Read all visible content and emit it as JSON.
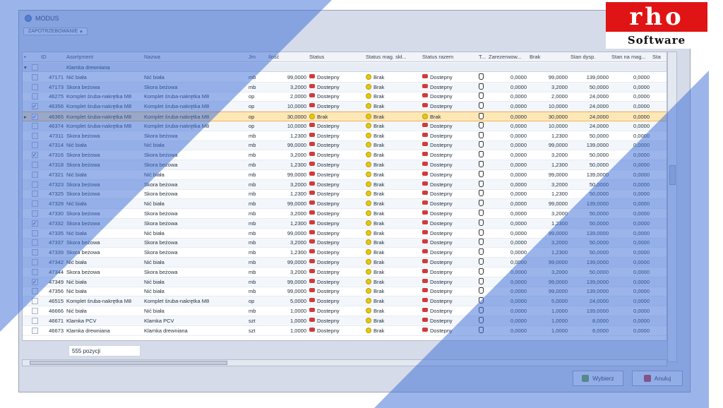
{
  "app": {
    "title": "MODUS",
    "filter_chip": "ZAPOTRZEBOWANIE"
  },
  "columns": [
    "ID",
    "Asortyment",
    "Nazwa",
    "Jm",
    "Ilość",
    "Status",
    "Status mag. skł...",
    "Status razem",
    "T...",
    "Zarezerwow...",
    "Brak",
    "Stan dysp.",
    "Stan na mag...",
    "Stan"
  ],
  "group_label": "Klamka drewniana",
  "rows": [
    {
      "chk": "",
      "id": "47171",
      "as": "Nić biała",
      "na": "Nić biała",
      "jm": "mb",
      "il": "99,0000",
      "st": "Dostepny",
      "sm": "Brak",
      "sr": "Dostepny",
      "za": "0,0000",
      "br": "99,0000",
      "sd": "139,0000",
      "sn": "0,0000"
    },
    {
      "chk": "",
      "id": "47173",
      "as": "Skora beżowa",
      "na": "Skora beżowa",
      "jm": "mb",
      "il": "3,2000",
      "st": "Dostepny",
      "sm": "Brak",
      "sr": "Dostepny",
      "za": "0,0000",
      "br": "3,2000",
      "sd": "50,0000",
      "sn": "0,0000"
    },
    {
      "chk": "",
      "id": "46275",
      "as": "Komplet śruba-nakrętka M8",
      "na": "Komplet śruba-nakrętka M8",
      "jm": "op",
      "il": "2,0000",
      "st": "Dostepny",
      "sm": "Brak",
      "sr": "Dostepny",
      "za": "0,0000",
      "br": "2,0000",
      "sd": "24,0000",
      "sn": "0,0000"
    },
    {
      "chk": "✓",
      "id": "46356",
      "as": "Komplet śruba-nakrętka M8",
      "na": "Komplet śruba-nakrętka M8",
      "jm": "op",
      "il": "10,0000",
      "st": "Dostepny",
      "sm": "Brak",
      "sr": "Dostepny",
      "za": "0,0000",
      "br": "10,0000",
      "sd": "24,0000",
      "sn": "0,0000"
    },
    {
      "chk": "✓",
      "id": "46365",
      "as": "Komplet śruba-nakrętka M8",
      "na": "Komplet śruba-nakrętka M8",
      "jm": "op",
      "il": "30,0000",
      "st": "Brak",
      "sm": "Brak",
      "sr": "Brak",
      "za": "0,0000",
      "br": "30,0000",
      "sd": "24,0000",
      "sn": "0,0000",
      "sel": true
    },
    {
      "chk": "",
      "id": "46374",
      "as": "Komplet śruba-nakrętka M8",
      "na": "Komplet śruba-nakrętka M8",
      "jm": "op",
      "il": "10,0000",
      "st": "Dostepny",
      "sm": "Brak",
      "sr": "Dostepny",
      "za": "0,0000",
      "br": "10,0000",
      "sd": "24,0000",
      "sn": "0,0000"
    },
    {
      "chk": "",
      "id": "47311",
      "as": "Skora beżowa",
      "na": "Skora beżowa",
      "jm": "mb",
      "il": "1,2300",
      "st": "Dostepny",
      "sm": "Brak",
      "sr": "Dostepny",
      "za": "0,0000",
      "br": "1,2300",
      "sd": "50,0000",
      "sn": "0,0000"
    },
    {
      "chk": "",
      "id": "47314",
      "as": "Nić biała",
      "na": "Nić biała",
      "jm": "mb",
      "il": "99,0000",
      "st": "Dostepny",
      "sm": "Brak",
      "sr": "Dostepny",
      "za": "0,0000",
      "br": "99,0000",
      "sd": "139,0000",
      "sn": "0,0000"
    },
    {
      "chk": "✓",
      "id": "47316",
      "as": "Skora beżowa",
      "na": "Skora beżowa",
      "jm": "mb",
      "il": "3,2000",
      "st": "Dostepny",
      "sm": "Brak",
      "sr": "Dostepny",
      "za": "0,0000",
      "br": "3,2000",
      "sd": "50,0000",
      "sn": "0,0000"
    },
    {
      "chk": "",
      "id": "47318",
      "as": "Skora beżowa",
      "na": "Skora beżowa",
      "jm": "mb",
      "il": "1,2300",
      "st": "Dostepny",
      "sm": "Brak",
      "sr": "Dostepny",
      "za": "0,0000",
      "br": "1,2300",
      "sd": "50,0000",
      "sn": "0,0000"
    },
    {
      "chk": "",
      "id": "47321",
      "as": "Nić biała",
      "na": "Nić biała",
      "jm": "mb",
      "il": "99,0000",
      "st": "Dostepny",
      "sm": "Brak",
      "sr": "Dostepny",
      "za": "0,0000",
      "br": "99,0000",
      "sd": "139,0000",
      "sn": "0,0000"
    },
    {
      "chk": "",
      "id": "47323",
      "as": "Skora beżowa",
      "na": "Skora beżowa",
      "jm": "mb",
      "il": "3,2000",
      "st": "Dostepny",
      "sm": "Brak",
      "sr": "Dostepny",
      "za": "0,0000",
      "br": "3,2000",
      "sd": "50,0000",
      "sn": "0,0000"
    },
    {
      "chk": "",
      "id": "47325",
      "as": "Skora beżowa",
      "na": "Skora beżowa",
      "jm": "mb",
      "il": "1,2300",
      "st": "Dostepny",
      "sm": "Brak",
      "sr": "Dostepny",
      "za": "0,0000",
      "br": "1,2300",
      "sd": "50,0000",
      "sn": "0,0000"
    },
    {
      "chk": "",
      "id": "47328",
      "as": "Nić biała",
      "na": "Nić biała",
      "jm": "mb",
      "il": "99,0000",
      "st": "Dostepny",
      "sm": "Brak",
      "sr": "Dostepny",
      "za": "0,0000",
      "br": "99,0000",
      "sd": "139,0000",
      "sn": "0,0000"
    },
    {
      "chk": "",
      "id": "47330",
      "as": "Skora beżowa",
      "na": "Skora beżowa",
      "jm": "mb",
      "il": "3,2000",
      "st": "Dostepny",
      "sm": "Brak",
      "sr": "Dostepny",
      "za": "0,0000",
      "br": "3,2000",
      "sd": "50,0000",
      "sn": "0,0000"
    },
    {
      "chk": "✓",
      "id": "47332",
      "as": "Skora beżowa",
      "na": "Skora beżowa",
      "jm": "mb",
      "il": "1,2300",
      "st": "Dostepny",
      "sm": "Brak",
      "sr": "Dostepny",
      "za": "0,0000",
      "br": "1,2300",
      "sd": "50,0000",
      "sn": "0,0000"
    },
    {
      "chk": "",
      "id": "47335",
      "as": "Nić biała",
      "na": "Nić biała",
      "jm": "mb",
      "il": "99,0000",
      "st": "Dostepny",
      "sm": "Brak",
      "sr": "Dostepny",
      "za": "0,0000",
      "br": "99,0000",
      "sd": "139,0000",
      "sn": "0,0000"
    },
    {
      "chk": "",
      "id": "47337",
      "as": "Skora beżowa",
      "na": "Skora beżowa",
      "jm": "mb",
      "il": "3,2000",
      "st": "Dostepny",
      "sm": "Brak",
      "sr": "Dostepny",
      "za": "0,0000",
      "br": "3,2000",
      "sd": "50,0000",
      "sn": "0,0000"
    },
    {
      "chk": "",
      "id": "47339",
      "as": "Skora beżowa",
      "na": "Skora beżowa",
      "jm": "mb",
      "il": "1,2300",
      "st": "Dostepny",
      "sm": "Brak",
      "sr": "Dostepny",
      "za": "0,0000",
      "br": "1,2300",
      "sd": "50,0000",
      "sn": "0,0000"
    },
    {
      "chk": "",
      "id": "47342",
      "as": "Nić biała",
      "na": "Nić biała",
      "jm": "mb",
      "il": "99,0000",
      "st": "Dostepny",
      "sm": "Brak",
      "sr": "Dostepny",
      "za": "0,0000",
      "br": "99,0000",
      "sd": "139,0000",
      "sn": "0,0000"
    },
    {
      "chk": "",
      "id": "47344",
      "as": "Skora beżowa",
      "na": "Skora beżowa",
      "jm": "mb",
      "il": "3,2000",
      "st": "Dostepny",
      "sm": "Brak",
      "sr": "Dostepny",
      "za": "0,0000",
      "br": "3,2000",
      "sd": "50,0000",
      "sn": "0,0000"
    },
    {
      "chk": "✓",
      "id": "47349",
      "as": "Nić biała",
      "na": "Nić biała",
      "jm": "mb",
      "il": "99,0000",
      "st": "Dostepny",
      "sm": "Brak",
      "sr": "Dostepny",
      "za": "0,0000",
      "br": "99,0000",
      "sd": "139,0000",
      "sn": "0,0000"
    },
    {
      "chk": "",
      "id": "47356",
      "as": "Nić biała",
      "na": "Nić biała",
      "jm": "mb",
      "il": "99,0000",
      "st": "Dostepny",
      "sm": "Brak",
      "sr": "Dostepny",
      "za": "0,0000",
      "br": "99,0000",
      "sd": "139,0000",
      "sn": "0,0000"
    },
    {
      "chk": "",
      "id": "46515",
      "as": "Komplet śruba-nakrętka M8",
      "na": "Komplet śruba-nakrętka M8",
      "jm": "op",
      "il": "5,0000",
      "st": "Dostepny",
      "sm": "Brak",
      "sr": "Dostepny",
      "za": "0,0000",
      "br": "5,0000",
      "sd": "24,0000",
      "sn": "0,0000"
    },
    {
      "chk": "",
      "id": "46666",
      "as": "Nić biała",
      "na": "Nić biała",
      "jm": "mb",
      "il": "1,0000",
      "st": "Dostepny",
      "sm": "Brak",
      "sr": "Dostepny",
      "za": "0,0000",
      "br": "1,0000",
      "sd": "139,0000",
      "sn": "0,0000"
    },
    {
      "chk": "",
      "id": "46671",
      "as": "Klamka PCV",
      "na": "Klamka PCV",
      "jm": "szt",
      "il": "1,0000",
      "st": "Dostepny",
      "sm": "Brak",
      "sr": "Dostepny",
      "za": "0,0000",
      "br": "1,0000",
      "sd": "8,0000",
      "sn": "0,0000"
    },
    {
      "chk": "",
      "id": "46673",
      "as": "Klamka drewniana",
      "na": "Klamka drewniana",
      "jm": "szt",
      "il": "1,0000",
      "st": "Dostepny",
      "sm": "Brak",
      "sr": "Dostepny",
      "za": "0,0000",
      "br": "1,0000",
      "sd": "8,0000",
      "sn": "0,0000"
    }
  ],
  "footer": {
    "count": "555 pozycji",
    "hscroll_label": "III"
  },
  "buttons": {
    "select": "Wybierz",
    "cancel": "Anuluj"
  },
  "logo": {
    "top": "rho",
    "bottom": "Software"
  },
  "colors": {
    "overlay_blue": "#3f6fd6",
    "logo_red": "#e01414",
    "selected_row": "#fde7b6"
  },
  "icons": [
    "shield-status-icon",
    "warning-status-icon",
    "hand-icon",
    "select-icon",
    "cancel-icon"
  ]
}
